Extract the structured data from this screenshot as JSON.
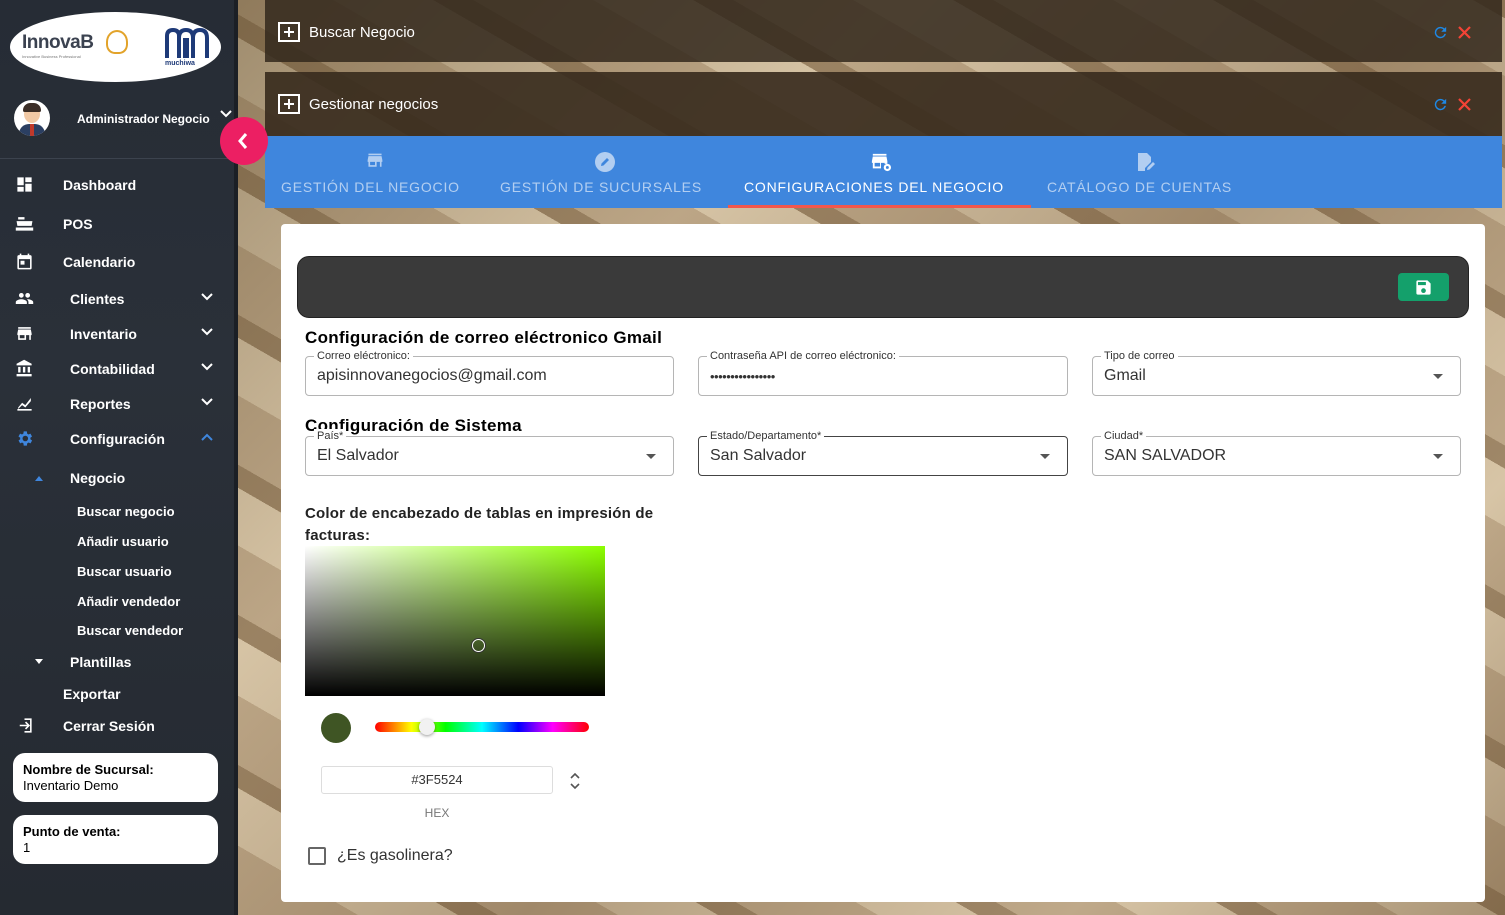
{
  "sidebar": {
    "logo_text": "InnovaB",
    "logo_subtext": "Innovative Business Professional",
    "logo2_text": "muchiwa",
    "user_name": "Administrador Negocio",
    "nav": [
      {
        "label": "Dashboard",
        "icon": "dashboard-icon"
      },
      {
        "label": "POS",
        "icon": "cash-register-icon"
      },
      {
        "label": "Calendario",
        "icon": "calendar-icon"
      },
      {
        "label": "Clientes",
        "icon": "people-icon"
      },
      {
        "label": "Inventario",
        "icon": "store-icon"
      },
      {
        "label": "Contabilidad",
        "icon": "bank-icon"
      },
      {
        "label": "Reportes",
        "icon": "chart-icon"
      },
      {
        "label": "Configuración",
        "icon": "gear-icon"
      }
    ],
    "config_sub": {
      "negocio": "Negocio",
      "items": [
        "Buscar negocio",
        "Añadir usuario",
        "Buscar usuario",
        "Añadir vendedor",
        "Buscar vendedor"
      ],
      "plantillas": "Plantillas",
      "exportar": "Exportar"
    },
    "logout": "Cerrar Sesión",
    "branch_card": {
      "title": "Nombre de Sucursal:",
      "value": "Inventario Demo"
    },
    "pos_card": {
      "title": "Punto de venta:",
      "value": "1"
    }
  },
  "panels": {
    "search_title": "Buscar Negocio",
    "manage_title": "Gestionar negocios"
  },
  "tabs": [
    {
      "label": "GESTIÓN DEL NEGOCIO",
      "icon": "store-icon",
      "active": false
    },
    {
      "label": "GESTIÓN DE SUCURSALES",
      "icon": "edit-circle-icon",
      "active": false
    },
    {
      "label": "CONFIGURACIONES DEL NEGOCIO",
      "icon": "store-settings-icon",
      "active": true
    },
    {
      "label": "CATÁLOGO DE CUENTAS",
      "icon": "edit-document-icon",
      "active": false
    }
  ],
  "form": {
    "gmail_section": "Configuración de correo eléctronico Gmail",
    "email_label": "Correo eléctronico:",
    "email_value": "apisinnovanegocios@gmail.com",
    "password_label": "Contraseña API de correo eléctronico:",
    "password_value": "••••••••••••••••",
    "mail_type_label": "Tipo de correo",
    "mail_type_value": "Gmail",
    "system_section": "Configuración de Sistema",
    "country_label": "País*",
    "country_value": "El Salvador",
    "state_label": "Estado/Departamento*",
    "state_value": "San Salvador",
    "city_label": "Ciudad*",
    "city_value": "SAN SALVADOR",
    "color_title": "Color de encabezado de tablas en impresión de facturas:",
    "hex_value": "#3F5524",
    "hex_label": "HEX",
    "gas_label": "¿Es gasolinera?",
    "gas_checked": false
  },
  "colors": {
    "accent_pink": "#ec1f63",
    "tab_blue": "#3f86dd",
    "save_green": "#14a06b",
    "selected_color": "#3F5524",
    "refresh_blue": "#1e88e5",
    "close_red": "#f44336"
  }
}
